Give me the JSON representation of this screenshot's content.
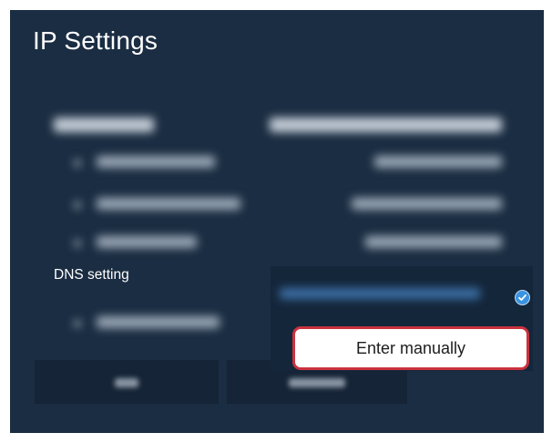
{
  "dialog": {
    "title": "IP Settings",
    "dns_setting_label": "DNS setting",
    "dropdown": {
      "options": [
        {
          "label": "",
          "selected": true,
          "obscured": true
        },
        {
          "label": "Enter manually",
          "focused": true
        }
      ]
    },
    "colors": {
      "panel_bg": "#1b2d42",
      "dropdown_bg": "#14263a",
      "focus_border": "#c9323e",
      "check": "#3a93e0"
    }
  }
}
